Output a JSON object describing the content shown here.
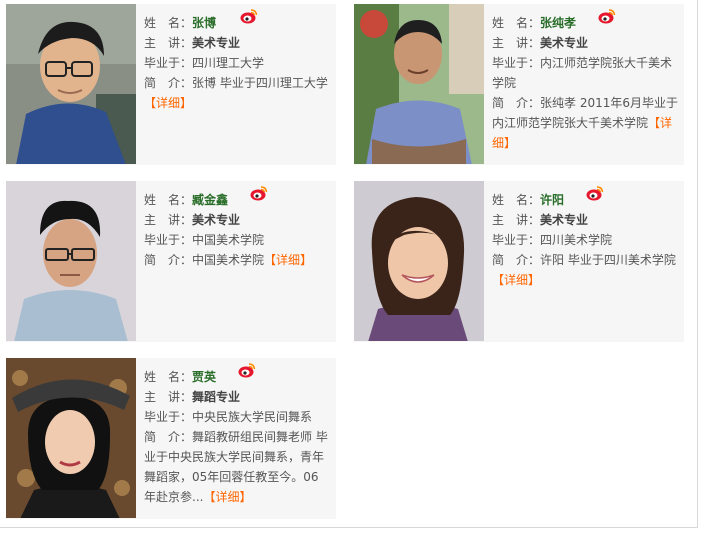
{
  "labels": {
    "name": "姓　名：",
    "lecture": "主　讲：",
    "graduated": "毕业于：",
    "intro": "简　介：",
    "more_open": "【",
    "more": "详细",
    "more_close": "】"
  },
  "colors": {
    "card_bg": "#f6f6f6",
    "name": "#2a6e2a",
    "more_link": "#ff6600",
    "weibo_red": "#e6162d"
  },
  "icons": {
    "weibo": "sina-weibo-icon"
  },
  "teachers": [
    {
      "name": "张博",
      "major": "美术专业",
      "school": "四川理工大学",
      "intro": "张博 毕业于四川理工大学"
    },
    {
      "name": "张纯孝",
      "major": "美术专业",
      "school": "内江师范学院张大千美术学院",
      "intro": "张纯孝 2011年6月毕业于内江师范学院张大千美术学院"
    },
    {
      "name": "臧金鑫",
      "major": "美术专业",
      "school": "中国美术学院",
      "intro": "中国美术学院"
    },
    {
      "name": "许阳",
      "major": "美术专业",
      "school": "四川美术学院",
      "intro": "许阳 毕业于四川美术学院"
    },
    {
      "name": "贾英",
      "major": "舞蹈专业",
      "school": "中央民族大学民间舞系",
      "intro": "舞蹈教研组民间舞老师 毕业于中央民族大学民间舞系，青年舞蹈家，05年回蓉任教至今。06年赴京参..."
    }
  ]
}
